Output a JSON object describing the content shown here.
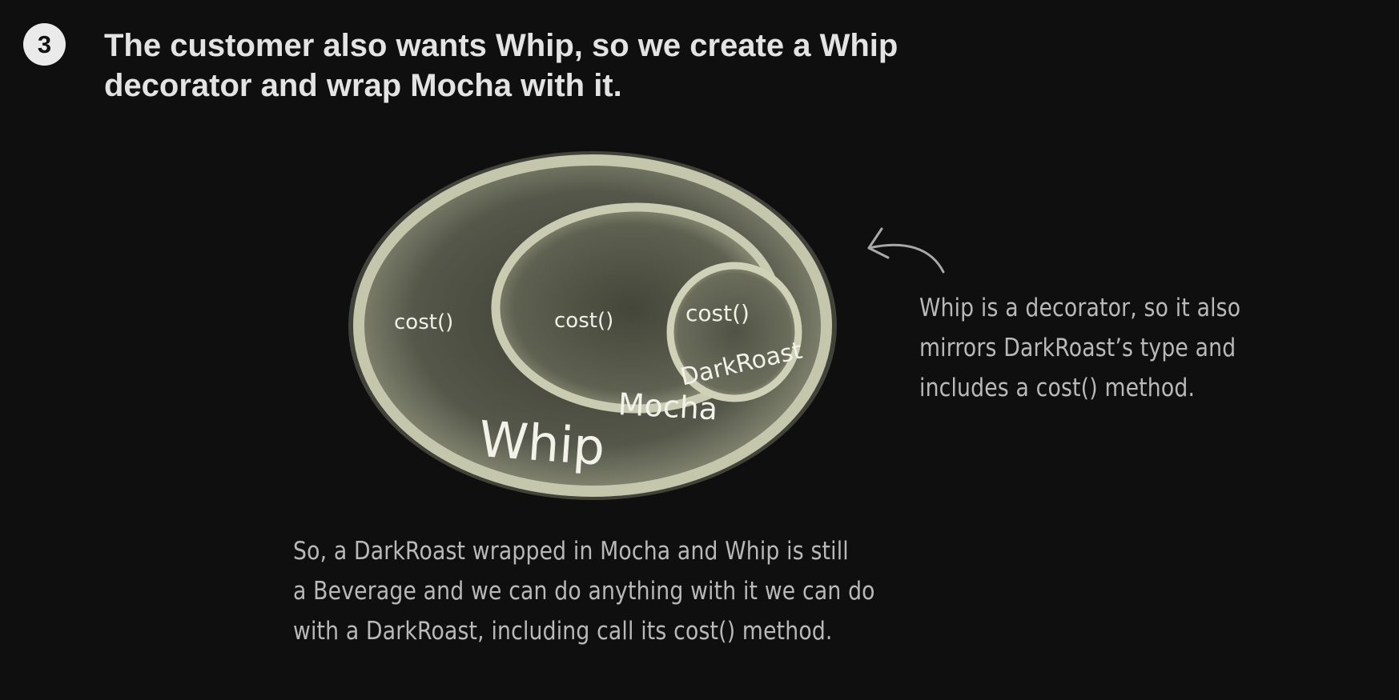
{
  "step": {
    "number": "3"
  },
  "heading": {
    "line1": "The customer also wants Whip, so we create a Whip",
    "line2": "decorator and wrap Mocha with it."
  },
  "diagram": {
    "layers": [
      {
        "name": "Whip",
        "method": "cost()"
      },
      {
        "name": "Mocha",
        "method": "cost()"
      },
      {
        "name": "DarkRoast",
        "method": "cost()"
      }
    ],
    "colors": {
      "ring": "#b9bca0",
      "ring_light": "#d6d9bd",
      "inner_fill": "#4a4c40",
      "label": "#f2f2ea"
    }
  },
  "annotations": {
    "whip_note": {
      "lines": [
        "Whip is a decorator, so it also",
        "mirrors DarkRoast’s type and",
        "includes a cost() method."
      ]
    },
    "summary_note": {
      "lines": [
        "So, a DarkRoast wrapped in Mocha and Whip is still",
        "a Beverage and we can do anything with it we can do",
        "with a DarkRoast, including call its cost() method."
      ]
    }
  }
}
